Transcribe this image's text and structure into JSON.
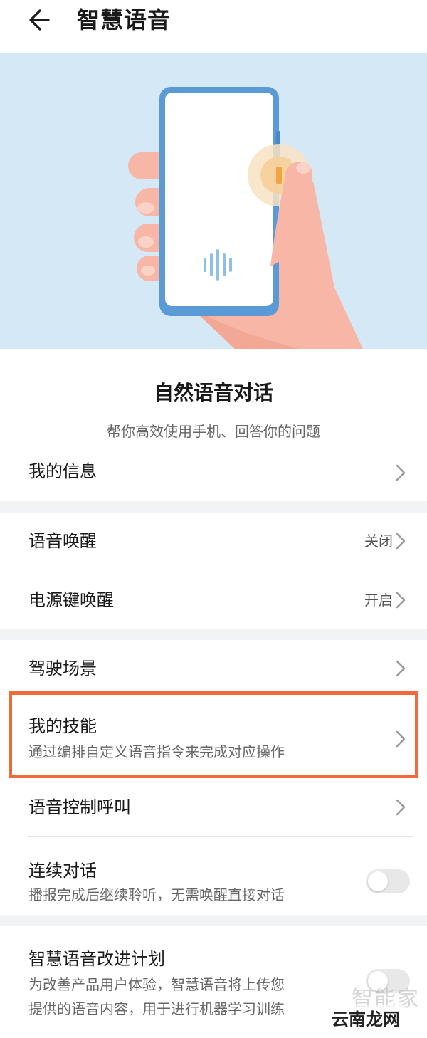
{
  "header": {
    "title": "智慧语音",
    "back_icon": "arrow-left-icon"
  },
  "hero": {
    "illustration": "hand-holding-phone-illustration",
    "bg_color": "#d5e8f5"
  },
  "intro": {
    "title": "自然语音对话",
    "subtitle": "帮你高效使用手机、回答你的问题"
  },
  "items": {
    "my_info": {
      "label": "我的信息"
    },
    "voice_wake": {
      "label": "语音唤醒",
      "value": "关闭"
    },
    "power_wake": {
      "label": "电源键唤醒",
      "value": "开启"
    },
    "driving": {
      "label": "驾驶场景"
    },
    "my_skills": {
      "label": "我的技能",
      "desc": "通过编排自定义语音指令来完成对应操作"
    },
    "voice_call": {
      "label": "语音控制呼叫"
    },
    "continuous": {
      "label": "连续对话",
      "desc": "播报完成后继续聆听，无需唤醒直接对话",
      "enabled": false
    },
    "improve": {
      "label": "智慧语音改进计划",
      "desc_line1": "为改善产品用户体验，智慧语音将上传您",
      "desc_line2": "提供的语音内容，用于进行机器学习训练",
      "enabled": false
    }
  },
  "highlight_color": "#f36a3a",
  "watermark": {
    "text": "云南龙网",
    "ghost": "智能家"
  }
}
